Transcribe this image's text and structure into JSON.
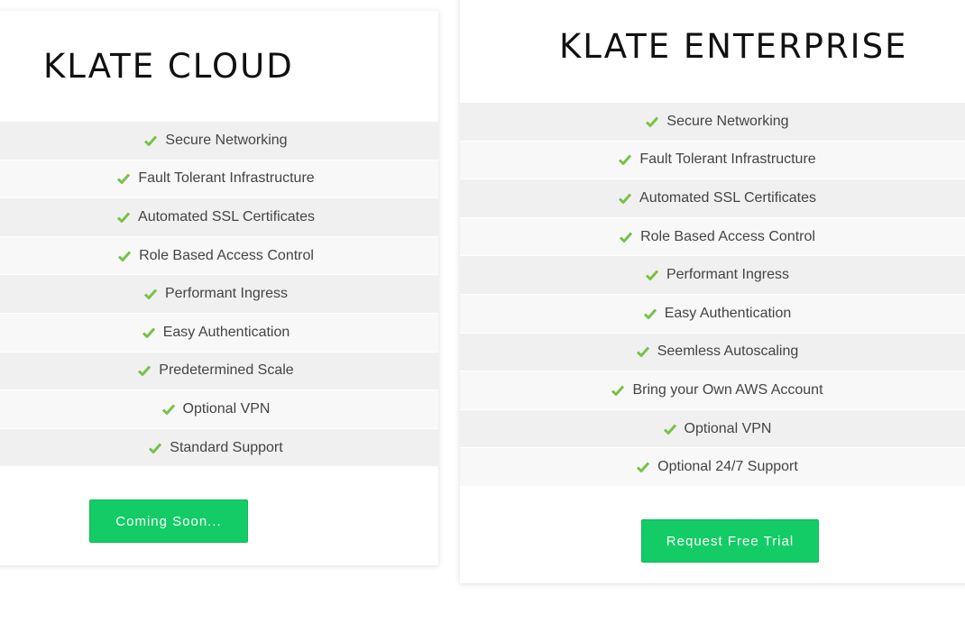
{
  "colors": {
    "accent": "#13cc66",
    "check": "#78c14a"
  },
  "cloud": {
    "title": "KLATE CLOUD",
    "features": [
      "Secure Networking",
      "Fault Tolerant Infrastructure",
      "Automated SSL Certificates",
      "Role Based Access Control",
      "Performant Ingress",
      "Easy Authentication",
      "Predetermined Scale",
      "Optional VPN",
      "Standard Support"
    ],
    "cta_label": "Coming Soon..."
  },
  "enterprise": {
    "title": "KLATE ENTERPRISE",
    "features": [
      "Secure Networking",
      "Fault Tolerant Infrastructure",
      "Automated SSL Certificates",
      "Role Based Access Control",
      "Performant Ingress",
      "Easy Authentication",
      "Seemless Autoscaling",
      "Bring your Own AWS Account",
      "Optional VPN",
      "Optional 24/7 Support"
    ],
    "cta_label": "Request Free Trial"
  }
}
